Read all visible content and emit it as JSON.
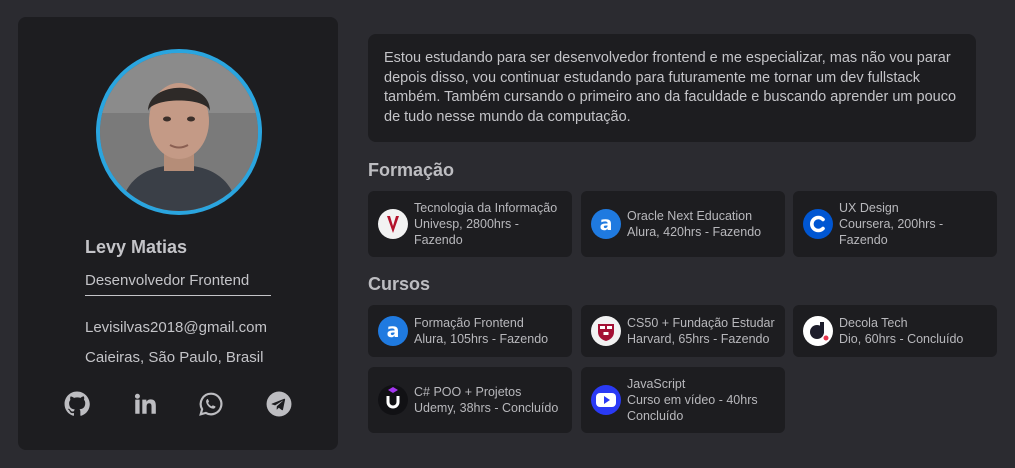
{
  "profile": {
    "name": "Levy Matias",
    "role": "Desenvolvedor Frontend",
    "email": "Levisilvas2018@gmail.com",
    "location": "Caieiras, São Paulo, Brasil",
    "socials": [
      "github-icon",
      "linkedin-icon",
      "whatsapp-icon",
      "telegram-icon"
    ]
  },
  "about": "Estou estudando para ser desenvolvedor frontend e me especializar, mas não vou parar depois disso, vou continuar estudando para futuramente me tornar um dev fullstack também. Também cursando o primeiro ano da faculdade e buscando aprender um pouco de tudo nesse mundo da computação.",
  "formacao": {
    "title": "Formação",
    "items": [
      {
        "line1": "Tecnologia da Informação",
        "line2": "Univesp, 2800hrs -",
        "line3": "Fazendo",
        "icon": "univesp-logo-icon"
      },
      {
        "line1": "Oracle Next Education",
        "line2": "Alura, 420hrs - Fazendo",
        "line3": "",
        "icon": "alura-logo-icon"
      },
      {
        "line1": "UX Design",
        "line2": "Coursera, 200hrs -",
        "line3": "Fazendo",
        "icon": "coursera-logo-icon"
      }
    ]
  },
  "cursos": {
    "title": "Cursos",
    "items": [
      {
        "line1": "Formação Frontend",
        "line2": "Alura, 105hrs - Fazendo",
        "line3": "",
        "icon": "alura-logo-icon"
      },
      {
        "line1": "CS50 + Fundação Estudar",
        "line2": "Harvard, 65hrs - Fazendo",
        "line3": "",
        "icon": "harvard-logo-icon"
      },
      {
        "line1": "Decola Tech",
        "line2": "Dio, 60hrs - Concluído",
        "line3": "",
        "icon": "dio-logo-icon"
      },
      {
        "line1": "C# POO + Projetos",
        "line2": "Udemy, 38hrs - Concluído",
        "line3": "",
        "icon": "udemy-logo-icon"
      },
      {
        "line1": "JavaScript",
        "line2": "Curso em vídeo - 40hrs",
        "line3": "Concluído",
        "icon": "cursoemvideo-logo-icon"
      }
    ]
  },
  "colors": {
    "background": "#2b2b30",
    "card": "#1d1d20",
    "avatar_ring": "#2aa5df",
    "alura": "#1f7ae0",
    "coursera": "#0056d2",
    "harvard": "#a41034",
    "udemy_accent": "#a435f0",
    "cursoemvideo": "#2a3af5"
  }
}
